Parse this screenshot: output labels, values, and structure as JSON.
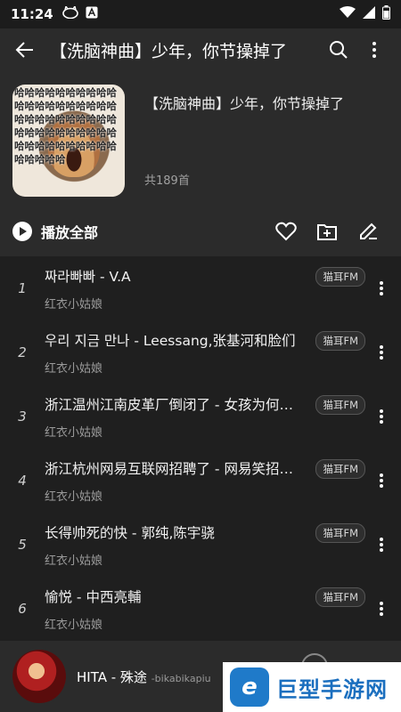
{
  "status_bar": {
    "time": "11:24",
    "icons": [
      "cat-icon",
      "a-icon",
      "wifi-icon",
      "signal-icon",
      "battery-icon"
    ]
  },
  "app_bar": {
    "title": "【洗脑神曲】少年，你节操掉了"
  },
  "playlist": {
    "title": "【洗脑神曲】少年，你节操掉了",
    "count": "共189首",
    "cover_text": "哈哈哈哈哈哈哈哈哈哈哈哈哈哈哈哈哈哈哈哈哈哈哈哈哈哈哈哈哈哈哈哈哈哈哈哈哈哈哈哈哈哈哈哈哈哈哈哈哈哈哈哈哈哈哈"
  },
  "actions": {
    "play_all": "播放全部"
  },
  "songs": [
    {
      "num": "1",
      "name": "짜라빠빠 - V.A",
      "artist": "红衣小姑娘",
      "badge": "猫耳FM"
    },
    {
      "num": "2",
      "name": "우리 지금 만나 - Leessang,张基河和脸们",
      "artist": "红衣小姑娘",
      "badge": "猫耳FM"
    },
    {
      "num": "3",
      "name": "浙江温州江南皮革厂倒闭了 - 女孩为何…",
      "artist": "红衣小姑娘",
      "badge": "猫耳FM"
    },
    {
      "num": "4",
      "name": "浙江杭州网易互联网招聘了 - 网易笑招…",
      "artist": "红衣小姑娘",
      "badge": "猫耳FM"
    },
    {
      "num": "5",
      "name": "长得帅死的快 - 郭纯,陈宇骁",
      "artist": "红衣小姑娘",
      "badge": "猫耳FM"
    },
    {
      "num": "6",
      "name": "愉悦 - 中西亮輔",
      "artist": "红衣小姑娘",
      "badge": "猫耳FM"
    }
  ],
  "player": {
    "title": "HITA - 殊途",
    "sub": "-bikabikapiu"
  },
  "watermark": {
    "logo_letter": "e",
    "text": "巨型手游网"
  },
  "colors": {
    "background": "#2b2b2b",
    "list_bg": "#1f1f1f",
    "watermark_blue": "#1b6fbf"
  }
}
